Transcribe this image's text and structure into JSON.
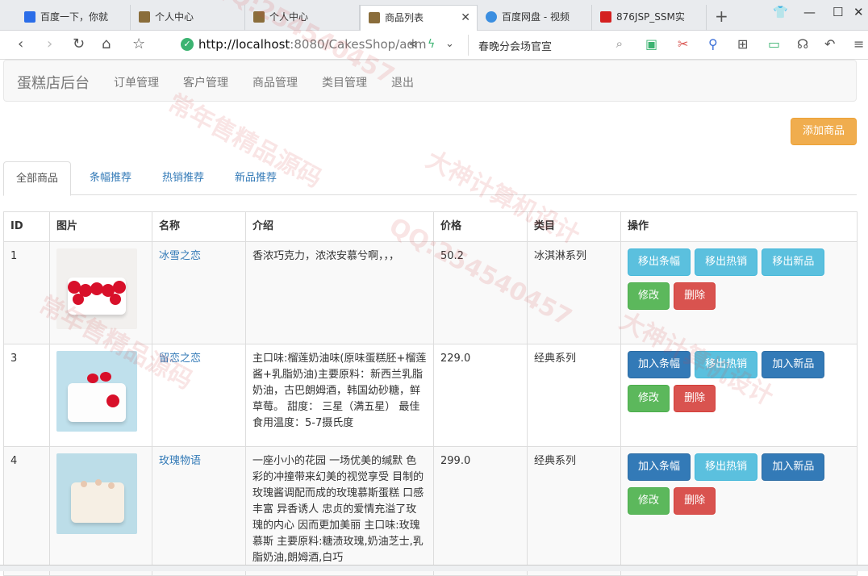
{
  "browser": {
    "tabs": [
      {
        "title": "百度一下，你就",
        "color": "#2b6de8"
      },
      {
        "title": "个人中心",
        "color": "#8a6d3b"
      },
      {
        "title": "个人中心",
        "color": "#8a6d3b"
      },
      {
        "title": "商品列表",
        "color": "#8a6d3b"
      },
      {
        "title": "百度网盘 - 视频",
        "color": "#3b8ee0"
      },
      {
        "title": "876JSP_SSM实",
        "color": "#d42020"
      }
    ],
    "new_tab_label": "+",
    "url_host": "http://localhost",
    "url_rest": ":8080/CakesShop/adm",
    "search_text": "春晚分会场官宣"
  },
  "navbar": {
    "brand": "蛋糕店后台",
    "links": [
      "订单管理",
      "客户管理",
      "商品管理",
      "类目管理",
      "退出"
    ]
  },
  "add_button": "添加商品",
  "tabs": [
    "全部商品",
    "条幅推荐",
    "热销推荐",
    "新品推荐"
  ],
  "table": {
    "headers": [
      "ID",
      "图片",
      "名称",
      "介绍",
      "价格",
      "类目",
      "操作"
    ],
    "rows": [
      {
        "id": "1",
        "name": "冰雪之恋",
        "intro": "香浓巧克力，浓浓安慕兮啊，，，",
        "price": "50.2",
        "category": "冰淇淋系列",
        "banner_btn": "移出条幅",
        "hot_btn": "移出热销",
        "new_btn": "移出新品",
        "edit_btn": "修改",
        "delete_btn": "删除"
      },
      {
        "id": "3",
        "name": "留恋之恋",
        "intro": "主口味:榴莲奶油味(原味蛋糕胚+榴莲酱+乳脂奶油)主要原料：新西兰乳脂奶油，古巴朗姆酒，韩国幼砂糖，鲜草莓。 甜度： 三星（满五星） 最佳食用温度：5-7摄氏度",
        "price": "229.0",
        "category": "经典系列",
        "banner_btn": "加入条幅",
        "hot_btn": "移出热销",
        "new_btn": "加入新品",
        "edit_btn": "修改",
        "delete_btn": "删除"
      },
      {
        "id": "4",
        "name": "玫瑰物语",
        "intro": "一座小小的花园 一场优美的缄默 色彩的冲撞带来幻美的视觉享受 目制的玫瑰酱调配而成的玫瑰慕斯蛋糕 口感丰富 异香诱人 忠贞的爱情充溢了玫瑰的内心 因而更加美丽 主口味:玫瑰慕斯 主要原料:糖渍玫瑰,奶油芝士,乳脂奶油,朗姆酒,白巧",
        "price": "299.0",
        "category": "经典系列",
        "banner_btn": "加入条幅",
        "hot_btn": "移出热销",
        "new_btn": "加入新品",
        "edit_btn": "修改",
        "delete_btn": "删除"
      }
    ]
  },
  "watermarks": [
    "QQ:254540457",
    "常年售精品源码",
    "大神计算机设计",
    "QQ:254540457",
    "常年售精品源码",
    "大神计算机设计"
  ]
}
